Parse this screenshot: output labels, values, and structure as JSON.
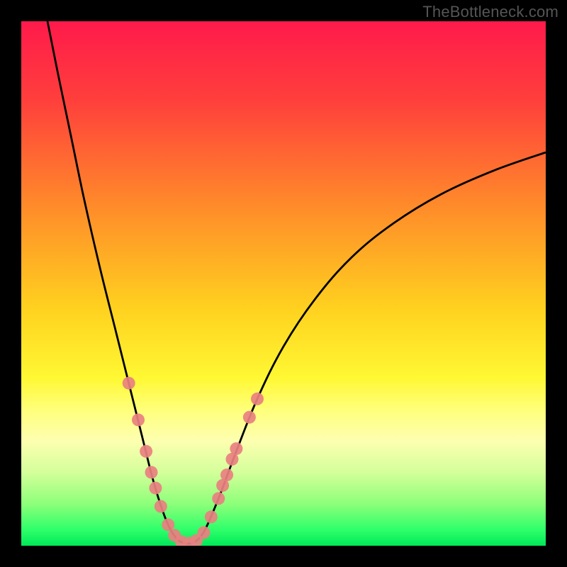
{
  "watermark": "TheBottleneck.com",
  "chart_data": {
    "type": "line",
    "title": "",
    "xlabel": "",
    "ylabel": "",
    "xlim": [
      0,
      100
    ],
    "ylim": [
      0,
      100
    ],
    "background_gradient": {
      "stops": [
        {
          "pos": 0.0,
          "color": "#ff1a4b"
        },
        {
          "pos": 0.15,
          "color": "#ff3f3c"
        },
        {
          "pos": 0.35,
          "color": "#ff8a2a"
        },
        {
          "pos": 0.55,
          "color": "#ffd21f"
        },
        {
          "pos": 0.68,
          "color": "#fff833"
        },
        {
          "pos": 0.74,
          "color": "#ffff7a"
        },
        {
          "pos": 0.8,
          "color": "#fdffb0"
        },
        {
          "pos": 0.86,
          "color": "#d4ff9a"
        },
        {
          "pos": 0.92,
          "color": "#8dff7a"
        },
        {
          "pos": 0.97,
          "color": "#2dff6a"
        },
        {
          "pos": 1.0,
          "color": "#00e858"
        }
      ]
    },
    "series": [
      {
        "name": "v-curve",
        "color": "#000000",
        "points": [
          {
            "x": 5.0,
            "y": 100.0
          },
          {
            "x": 7.0,
            "y": 90.0
          },
          {
            "x": 9.5,
            "y": 78.0
          },
          {
            "x": 12.0,
            "y": 66.0
          },
          {
            "x": 15.0,
            "y": 53.0
          },
          {
            "x": 18.0,
            "y": 41.0
          },
          {
            "x": 20.5,
            "y": 31.0
          },
          {
            "x": 23.0,
            "y": 21.0
          },
          {
            "x": 25.0,
            "y": 13.0
          },
          {
            "x": 26.5,
            "y": 8.0
          },
          {
            "x": 28.0,
            "y": 4.0
          },
          {
            "x": 29.5,
            "y": 1.5
          },
          {
            "x": 31.0,
            "y": 0.5
          },
          {
            "x": 32.5,
            "y": 0.5
          },
          {
            "x": 34.0,
            "y": 1.5
          },
          {
            "x": 35.5,
            "y": 4.0
          },
          {
            "x": 38.0,
            "y": 10.0
          },
          {
            "x": 41.0,
            "y": 18.0
          },
          {
            "x": 45.0,
            "y": 28.0
          },
          {
            "x": 50.0,
            "y": 38.0
          },
          {
            "x": 56.0,
            "y": 47.0
          },
          {
            "x": 63.0,
            "y": 55.0
          },
          {
            "x": 71.0,
            "y": 61.5
          },
          {
            "x": 80.0,
            "y": 67.0
          },
          {
            "x": 90.0,
            "y": 71.5
          },
          {
            "x": 100.0,
            "y": 75.0
          }
        ]
      }
    ],
    "markers": {
      "name": "highlight-dots",
      "color": "#e98080",
      "radius": 9,
      "points": [
        {
          "x": 20.5,
          "y": 31.0
        },
        {
          "x": 22.3,
          "y": 24.0
        },
        {
          "x": 23.8,
          "y": 18.0
        },
        {
          "x": 24.8,
          "y": 14.0
        },
        {
          "x": 25.6,
          "y": 11.0
        },
        {
          "x": 26.6,
          "y": 7.5
        },
        {
          "x": 28.0,
          "y": 4.0
        },
        {
          "x": 29.2,
          "y": 2.0
        },
        {
          "x": 30.5,
          "y": 0.8
        },
        {
          "x": 32.0,
          "y": 0.5
        },
        {
          "x": 33.4,
          "y": 1.0
        },
        {
          "x": 34.8,
          "y": 2.5
        },
        {
          "x": 36.2,
          "y": 5.5
        },
        {
          "x": 37.6,
          "y": 9.0
        },
        {
          "x": 38.4,
          "y": 11.5
        },
        {
          "x": 39.2,
          "y": 13.5
        },
        {
          "x": 40.2,
          "y": 16.5
        },
        {
          "x": 41.0,
          "y": 18.5
        },
        {
          "x": 43.5,
          "y": 24.5
        },
        {
          "x": 45.0,
          "y": 28.0
        }
      ]
    }
  }
}
